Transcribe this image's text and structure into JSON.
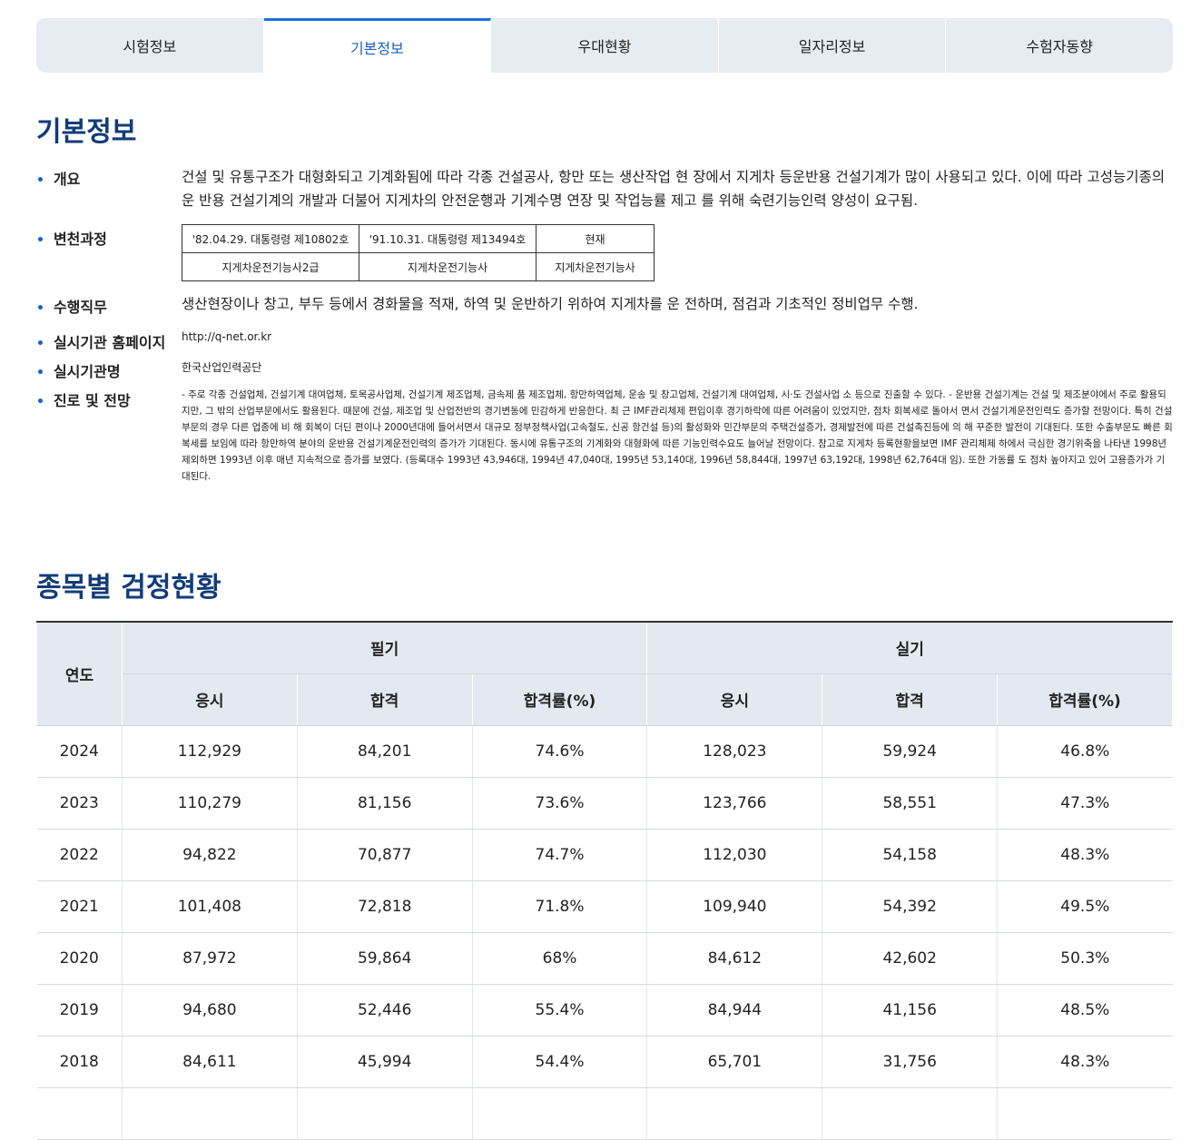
{
  "tabs": [
    "시험정보",
    "기본정보",
    "우대현황",
    "일자리정보",
    "수험자동향"
  ],
  "basic_info": {
    "title": "기본정보",
    "overview_label": "개요",
    "overview_text": "건설 및 유통구조가 대형화되고 기계화됨에 따라 각종 건설공사, 항만 또는 생산작업 현 장에서 지게차 등운반용 건설기계가 많이 사용되고 있다. 이에 따라 고성능기종의 운 반용 건설기계의 개발과 더불어 지게차의 안전운행과 기계수명 연장 및 작업능률 제고 를 위해 숙련기능인력 양성이 요구됨.",
    "history_label": "변천과정",
    "history": {
      "dates": [
        "'82.04.29. 대통령령 제10802호",
        "'91.10.31. 대통령령 제13494호",
        "현재"
      ],
      "names": [
        "지게차운전기능사2급",
        "지게차운전기능사",
        "지게차운전기능사"
      ]
    },
    "duty_label": "수행직무",
    "duty_text": "생산현장이나 창고, 부두 등에서 경화물을 적재, 하역 및 운반하기 위하여 지게차를 운 전하며, 점검과 기초적인 정비업무 수행.",
    "homepage_label": "실시기관 홈페이지",
    "homepage_value": "http://q-net.or.kr",
    "org_label": "실시기관명",
    "org_value": "한국산업인력공단",
    "career_label": "진로 및 전망",
    "career_text": "- 주로 각종 건설업체, 건설기계 대여업체, 토목공사업체, 건설기계 제조업체, 금속제 품 제조업체, 항만하역업체, 운송 및 창고업체, 건설기계 대여업체, 시·도 건설사업 소 등으로 진출할 수 있다. - 운반용 건설기계는 건설 및 제조분야에서 주로 활용되지만, 그 밖의 산업부문에서도 활용된다. 때문에 건설, 제조업 및 산업전반의 경기변동에 민감하게 반응한다. 최 근 IMF관리체제 편입이후 경기하락에 따른 어려움이 있었지만, 점차 회복세로 돌아서 면서 건설기계운전인력도 증가할 전망이다. 특히 건설부문의 경우 다른 업종에 비 해 회복이 더딘 편이나 2000년대에 들어서면서 대규모 정부정책사업(고속철도, 신공 항건설 등)의 활성화와 민간부문의 주택건설증가, 경제발전에 따른 건설촉진등에 의 해 꾸준한 발전이 기대된다. 또한 수출부문도 빠른 회복세를 보임에 따라 항만하역 분야의 운반용 건설기계운전인력의 증가가 기대된다. 동시에 유통구조의 기계화와 대형화에 따른 기능인력수요도 늘어날 전망이다. 참고로 지게차 등록현황을보면 IMF 관리체제 하에서 극심한 경기위축을 나타낸 1998년 제외하면 1993년 이후 매년 지속적으로 증가를 보였다. (등록대수 1993년 43,946대, 1994년 47,040대, 1995년 53,140대, 1996년 58,844대, 1997년 63,192대, 1998년 62,764대 임). 또한 가동률 도 점차 높아지고 있어 고용증가가 기대된다."
  },
  "stats": {
    "title": "종목별 검정현황",
    "year_header": "연도",
    "written_header": "필기",
    "practical_header": "실기",
    "sub_headers": [
      "응시",
      "합격",
      "합격률(%)",
      "응시",
      "합격",
      "합격률(%)"
    ],
    "rows": [
      [
        "2024",
        "112,929",
        "84,201",
        "74.6%",
        "128,023",
        "59,924",
        "46.8%"
      ],
      [
        "2023",
        "110,279",
        "81,156",
        "73.6%",
        "123,766",
        "58,551",
        "47.3%"
      ],
      [
        "2022",
        "94,822",
        "70,877",
        "74.7%",
        "112,030",
        "54,158",
        "48.3%"
      ],
      [
        "2021",
        "101,408",
        "72,818",
        "71.8%",
        "109,940",
        "54,392",
        "49.5%"
      ],
      [
        "2020",
        "87,972",
        "59,864",
        "68%",
        "84,612",
        "42,602",
        "50.3%"
      ],
      [
        "2019",
        "94,680",
        "52,446",
        "55.4%",
        "84,944",
        "41,156",
        "48.5%"
      ],
      [
        "2018",
        "84,611",
        "45,994",
        "54.4%",
        "65,701",
        "31,756",
        "48.3%"
      ],
      [
        "",
        "",
        "",
        "",
        "",
        "",
        ""
      ]
    ]
  }
}
